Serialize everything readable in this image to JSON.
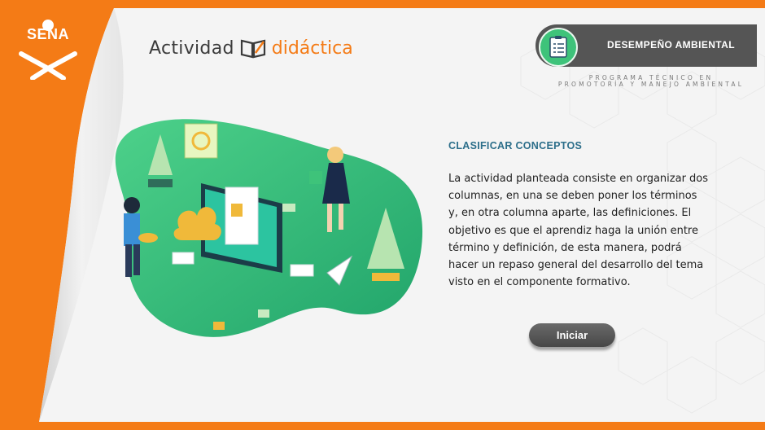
{
  "logo": {
    "text": "SENA"
  },
  "brand": {
    "part1": "Actividad",
    "part2": "didáctica"
  },
  "header": {
    "section_title": "DESEMPEÑO AMBIENTAL",
    "program_line1": "PROGRAMA TÉCNICO EN",
    "program_line2": "PROMOTORÍA Y MANEJO AMBIENTAL"
  },
  "activity": {
    "title": "CLASIFICAR CONCEPTOS",
    "description": "La actividad planteada consiste en organizar dos columnas, en una se deben poner los términos y, en otra columna aparte, las definiciones. El objetivo es que el aprendiz haga la unión entre término y definición, de esta manera, podrá hacer un repaso general del desarrollo del tema visto en el componente formativo.",
    "start_button": "Iniciar"
  },
  "colors": {
    "accent_orange": "#f47b16",
    "title_blue": "#2c6e8a",
    "green": "#3ec37a",
    "pill_gray": "#555555"
  }
}
